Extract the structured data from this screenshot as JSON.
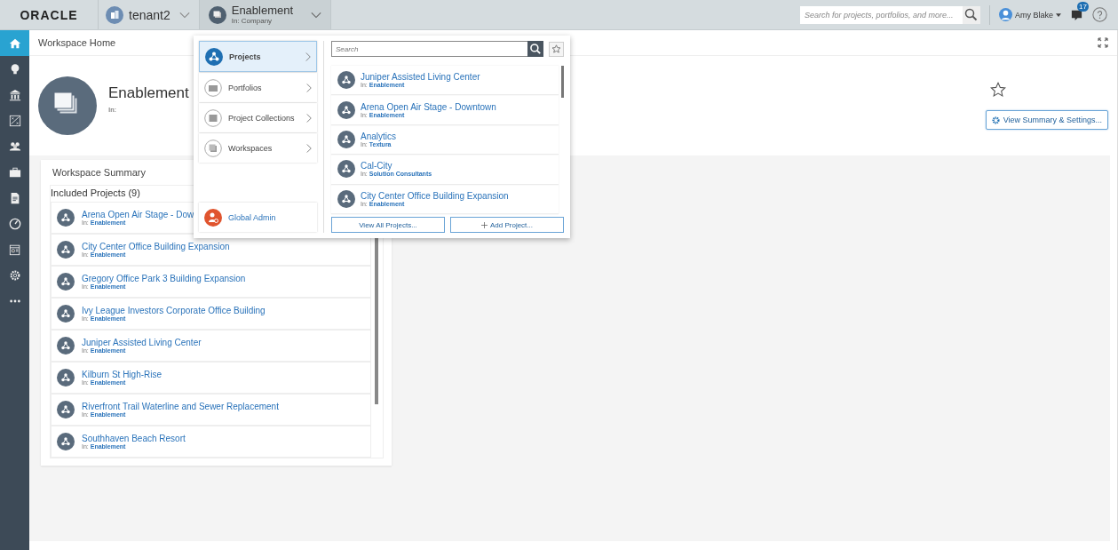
{
  "top_bar": {
    "logo": "ORACLE",
    "tenant": {
      "label": "tenant2"
    },
    "context": {
      "title": "Enablement",
      "subtitle": "In: Company"
    },
    "search": {
      "placeholder": "Search for projects, portfolios, and more..."
    },
    "user": {
      "name": "Amy Blake"
    },
    "notifications": {
      "count": "17"
    }
  },
  "sidebar": {
    "items": [
      {
        "kind": "home",
        "selected": true
      },
      {
        "kind": "bulb",
        "selected": false
      },
      {
        "kind": "bank",
        "selected": false
      },
      {
        "kind": "chart",
        "selected": false
      },
      {
        "kind": "people",
        "selected": false
      },
      {
        "kind": "briefcase",
        "selected": false
      },
      {
        "kind": "document",
        "selected": false
      },
      {
        "kind": "gauge",
        "selected": false
      },
      {
        "kind": "calendar",
        "selected": false
      },
      {
        "kind": "gear",
        "selected": false
      },
      {
        "kind": "more",
        "selected": false
      }
    ]
  },
  "header": {
    "title": "Workspace Home"
  },
  "workspace": {
    "name": "Enablement",
    "location": "In:",
    "favorite": false,
    "settings_button": "View Summary & Settings..."
  },
  "summary": {
    "title": "Workspace Summary",
    "projects_heading": "Included Projects (9)",
    "projects": [
      {
        "name": "Arena Open Air Stage - Dow",
        "location": "In: **Enablement**"
      },
      {
        "name": "City Center Office Building Expansion",
        "location": "In: **Enablement**"
      },
      {
        "name": "Gregory Office Park 3 Building Expansion",
        "location": "In: **Enablement**"
      },
      {
        "name": "Ivy League Investors Corporate Office Building",
        "location": "In: **Enablement**"
      },
      {
        "name": "Juniper Assisted Living Center",
        "location": "In: **Enablement**"
      },
      {
        "name": "Kilburn St High-Rise",
        "location": "In: **Enablement**"
      },
      {
        "name": "Riverfront Trail Waterline and Sewer Replacement",
        "location": "In: **Enablement**"
      },
      {
        "name": "Southhaven Beach Resort",
        "location": "In: **Enablement**"
      }
    ]
  },
  "dropdown": {
    "categories": [
      {
        "label": "Projects",
        "kind": "projects",
        "selected": true
      },
      {
        "label": "Portfolios",
        "kind": "portfolios",
        "selected": false
      },
      {
        "label": "Project Collections",
        "kind": "collections",
        "selected": false
      },
      {
        "label": "Workspaces",
        "kind": "workspaces",
        "selected": false
      }
    ],
    "admin": {
      "label": "Global Admin"
    },
    "search": {
      "placeholder": "Search"
    },
    "projects": [
      {
        "name": "Juniper Assisted Living Center",
        "location": "In: **Enablement**"
      },
      {
        "name": "Arena Open Air Stage - Downtown",
        "location": "In: **Enablement**"
      },
      {
        "name": "Analytics",
        "location": "In: **Textura**"
      },
      {
        "name": "Cal-City",
        "location": "In: **Solution Consultants**"
      },
      {
        "name": "City Center Office Building Expansion",
        "location": "In: **Enablement**"
      }
    ],
    "buttons": [
      {
        "label": "View All Projects...",
        "kind": "view"
      },
      {
        "label": "Add Project...",
        "kind": "add"
      }
    ]
  }
}
